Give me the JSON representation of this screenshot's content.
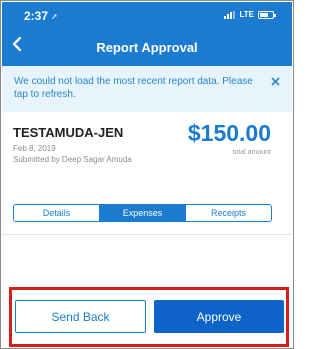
{
  "status_bar": {
    "time": "2:37",
    "network": "LTE"
  },
  "nav": {
    "title": "Report Approval",
    "back_icon": "chevron-left-icon"
  },
  "banner": {
    "message": "We could not load the most recent report data. Please tap to refresh.",
    "close_icon": "close-icon"
  },
  "report": {
    "name": "TESTAMUDA-JEN",
    "date": "Feb 8, 2019",
    "submitter": "Submitted by Deep Sagar Amuda",
    "amount": "$150.00",
    "amount_label": "total amount"
  },
  "tabs": [
    {
      "label": "Details",
      "active": false
    },
    {
      "label": "Expenses",
      "active": true
    },
    {
      "label": "Receipts",
      "active": false
    }
  ],
  "actions": {
    "send_back_label": "Send Back",
    "approve_label": "Approve"
  },
  "colors": {
    "brand_blue": "#1b7bd0",
    "approve_blue": "#0d63c7",
    "banner_bg": "#e8f4fc",
    "highlight_red": "#d51f1f"
  }
}
